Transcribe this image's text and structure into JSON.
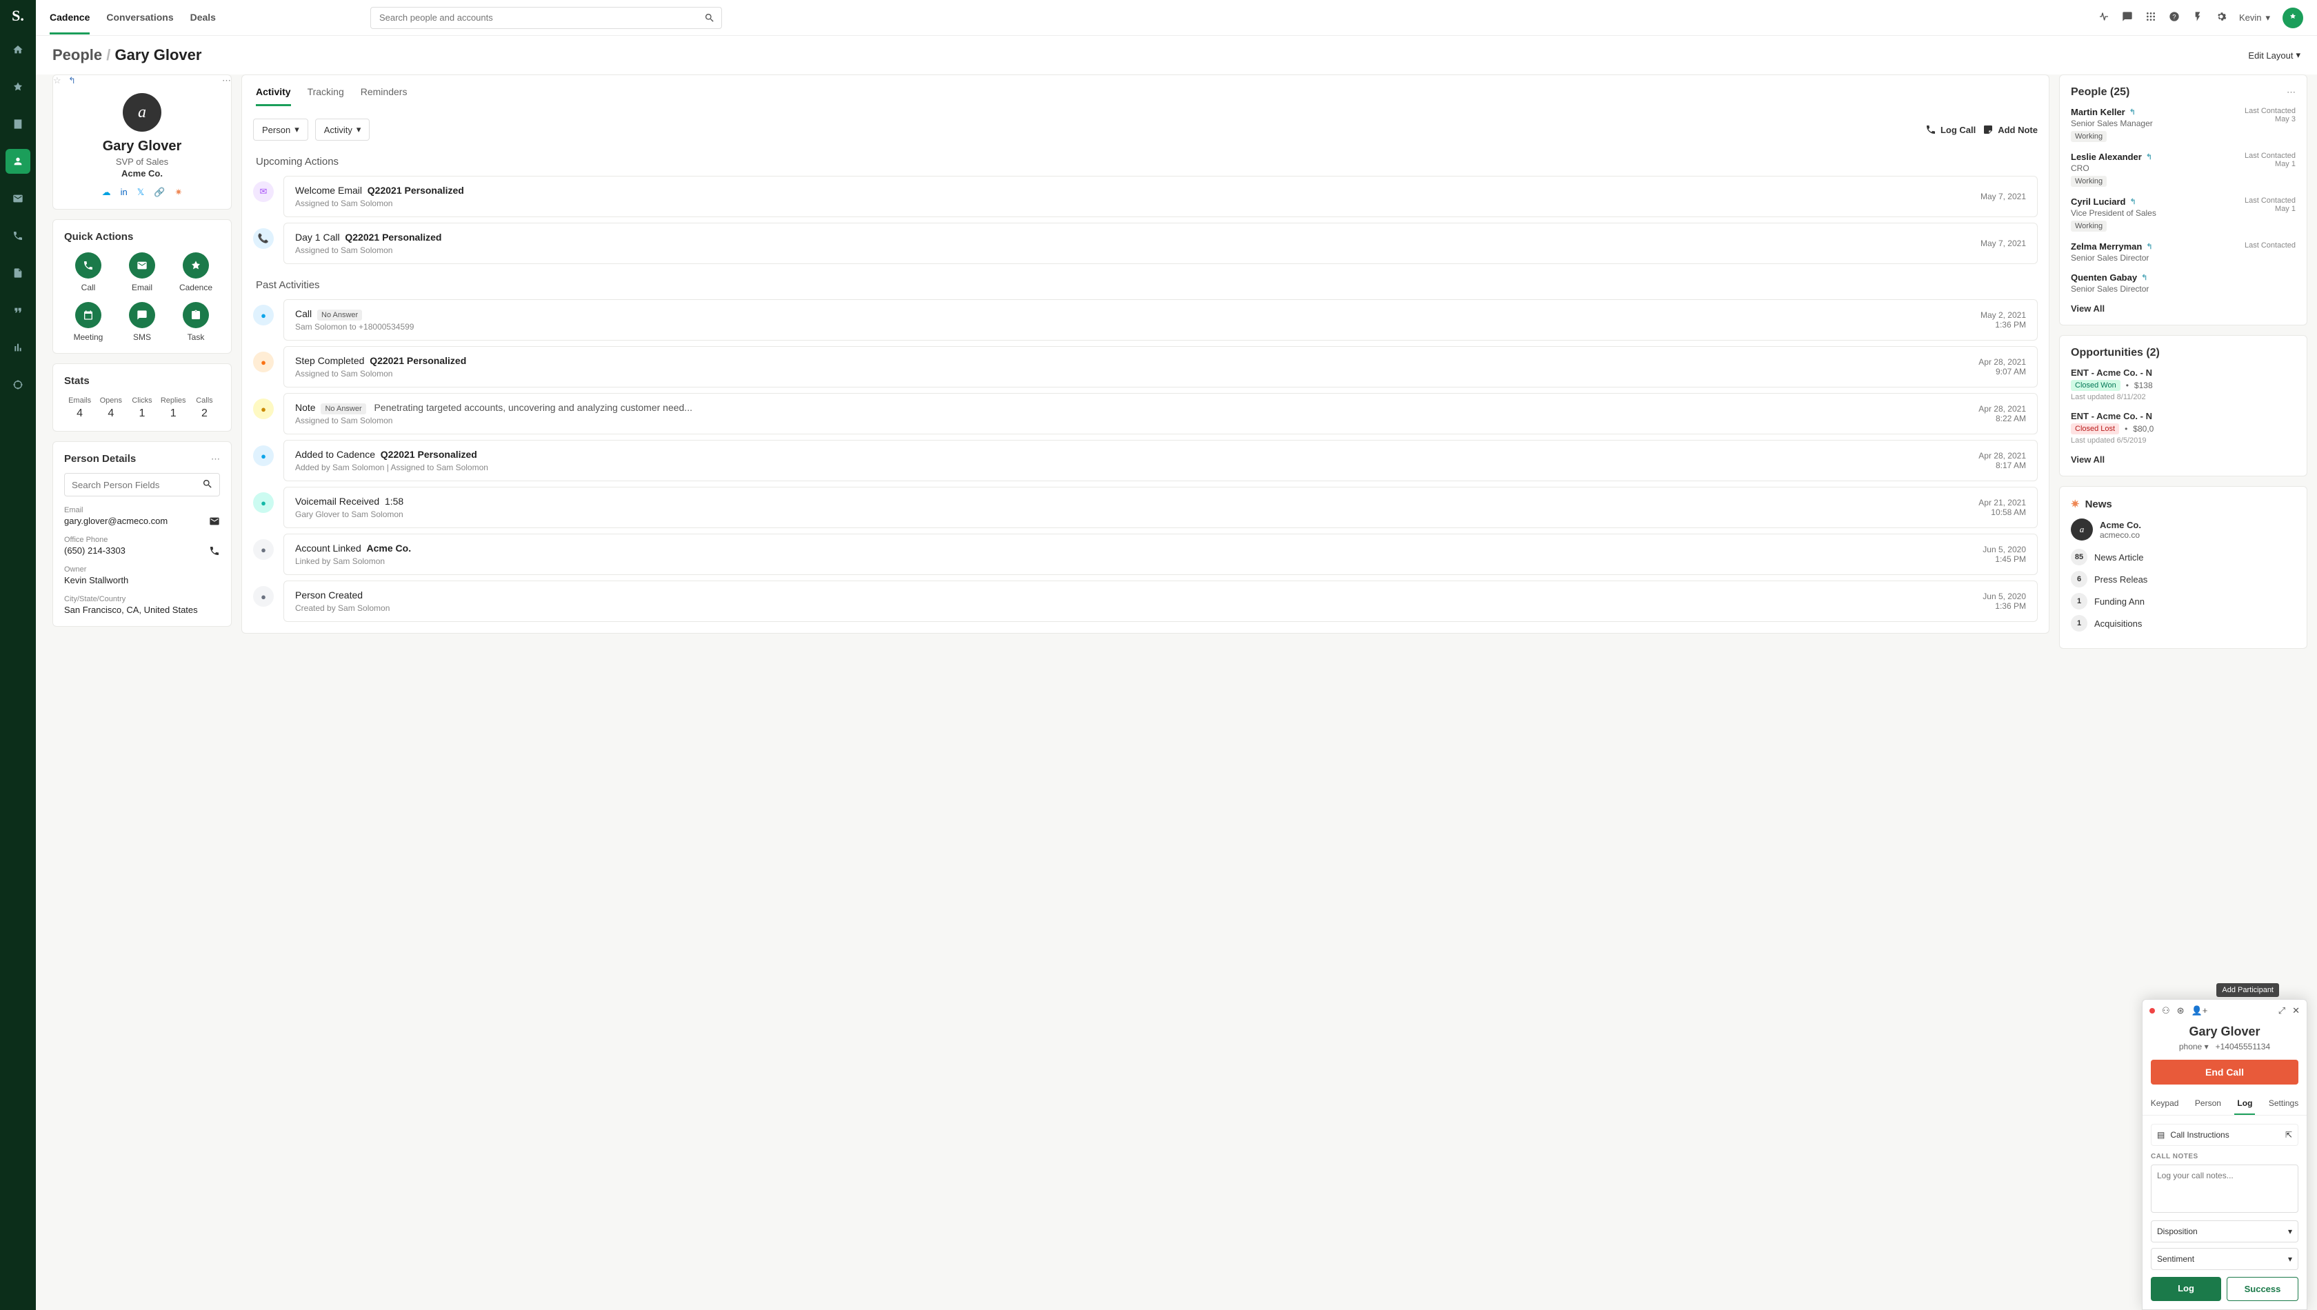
{
  "topnav": {
    "tabs": [
      "Cadence",
      "Conversations",
      "Deals"
    ],
    "active": 0,
    "search_placeholder": "Search people and accounts",
    "user_name": "Kevin"
  },
  "breadcrumb": {
    "root": "People",
    "current": "Gary Glover",
    "edit": "Edit Layout"
  },
  "profile": {
    "name": "Gary Glover",
    "title": "SVP of Sales",
    "company": "Acme Co."
  },
  "quick_actions": {
    "title": "Quick Actions",
    "items": [
      "Call",
      "Email",
      "Cadence",
      "Meeting",
      "SMS",
      "Task"
    ]
  },
  "stats": {
    "title": "Stats",
    "items": [
      {
        "label": "Emails",
        "value": "4"
      },
      {
        "label": "Opens",
        "value": "4"
      },
      {
        "label": "Clicks",
        "value": "1"
      },
      {
        "label": "Replies",
        "value": "1"
      },
      {
        "label": "Calls",
        "value": "2"
      }
    ]
  },
  "details": {
    "title": "Person Details",
    "search_placeholder": "Search Person Fields",
    "fields": [
      {
        "label": "Email",
        "value": "gary.glover@acmeco.com"
      },
      {
        "label": "Office Phone",
        "value": "(650) 214-3303"
      },
      {
        "label": "Owner",
        "value": "Kevin Stallworth"
      },
      {
        "label": "City/State/Country",
        "value": "San Francisco, CA, United States"
      }
    ]
  },
  "activity": {
    "tabs": [
      "Activity",
      "Tracking",
      "Reminders"
    ],
    "active": 0,
    "filter_person": "Person",
    "filter_activity": "Activity",
    "log_call": "Log Call",
    "add_note": "Add Note",
    "upcoming_label": "Upcoming Actions",
    "past_label": "Past Activities",
    "upcoming": [
      {
        "title": "Welcome Email",
        "cadence": "Q22021 Personalized",
        "sub": "Assigned to Sam Solomon",
        "date": "May 7, 2021"
      },
      {
        "title": "Day 1 Call",
        "cadence": "Q22021 Personalized",
        "sub": "Assigned to Sam Solomon",
        "date": "May 7, 2021"
      }
    ],
    "past": [
      {
        "title": "Call",
        "badge": "No Answer",
        "sub": "Sam Solomon to +18000534599",
        "date": "May 2, 2021",
        "time": "1:36 PM",
        "icon": "blue"
      },
      {
        "title": "Step Completed",
        "cadence": "Q22021 Personalized",
        "sub": "Assigned to Sam Solomon",
        "date": "Apr 28, 2021",
        "time": "9:07 AM",
        "icon": "orange"
      },
      {
        "title": "Note",
        "badge": "No Answer",
        "extra": "Penetrating targeted accounts, uncovering and analyzing customer need...",
        "sub": "Assigned to Sam Solomon",
        "date": "Apr 28, 2021",
        "time": "8:22 AM",
        "icon": "yellow"
      },
      {
        "title": "Added to Cadence",
        "cadence": "Q22021 Personalized",
        "sub": "Added by Sam Solomon | Assigned to Sam Solomon",
        "date": "Apr 28, 2021",
        "time": "8:17 AM",
        "icon": "blue"
      },
      {
        "title": "Voicemail Received",
        "extra2": "1:58",
        "sub": "Gary Glover to Sam Solomon",
        "date": "Apr 21, 2021",
        "time": "10:58 AM",
        "icon": "teal"
      },
      {
        "title": "Account Linked",
        "cadence": "Acme Co.",
        "sub": "Linked by Sam Solomon",
        "date": "Jun 5, 2020",
        "time": "1:45 PM",
        "icon": "gray"
      },
      {
        "title": "Person Created",
        "sub": "Created by Sam Solomon",
        "date": "Jun 5, 2020",
        "time": "1:36 PM",
        "icon": "gray"
      }
    ]
  },
  "people_panel": {
    "title": "People (25)",
    "items": [
      {
        "name": "Martin Keller",
        "role": "Senior Sales Manager",
        "tag": "Working",
        "contacted": "Last Contacted",
        "date": "May 3"
      },
      {
        "name": "Leslie Alexander",
        "role": "CRO",
        "tag": "Working",
        "contacted": "Last Contacted",
        "date": "May 1"
      },
      {
        "name": "Cyril Luciard",
        "role": "Vice President of Sales",
        "tag": "Working",
        "contacted": "Last Contacted",
        "date": "May 1"
      },
      {
        "name": "Zelma Merryman",
        "role": "Senior Sales Director",
        "contacted": "Last Contacted",
        "date": ""
      },
      {
        "name": "Quenten Gabay",
        "role": "Senior Sales Director",
        "contacted": "",
        "date": ""
      }
    ],
    "view_all": "View All"
  },
  "opportunities": {
    "title": "Opportunities (2)",
    "items": [
      {
        "name": "ENT - Acme Co. - N",
        "status": "Closed Won",
        "amount": "$138",
        "updated": "Last updated 8/11/202"
      },
      {
        "name": "ENT - Acme Co. - N",
        "status": "Closed Lost",
        "amount": "$80,0",
        "updated": "Last updated 6/5/2019"
      }
    ],
    "view_all": "View All"
  },
  "news": {
    "title": "News",
    "company": "Acme Co.",
    "domain": "acmeco.co",
    "items": [
      {
        "count": "85",
        "label": "News Article"
      },
      {
        "count": "6",
        "label": "Press Releas"
      },
      {
        "count": "1",
        "label": "Funding Ann"
      },
      {
        "count": "1",
        "label": "Acquisitions"
      }
    ]
  },
  "call_panel": {
    "tooltip": "Add Participant",
    "name": "Gary Glover",
    "phone_label": "phone",
    "phone": "+14045551134",
    "end_call": "End Call",
    "tabs": [
      "Keypad",
      "Person",
      "Log",
      "Settings"
    ],
    "active": 2,
    "instructions": "Call Instructions",
    "notes_label": "CALL NOTES",
    "notes_placeholder": "Log your call notes...",
    "disposition": "Disposition",
    "sentiment": "Sentiment",
    "log_btn": "Log",
    "success_btn": "Success"
  }
}
